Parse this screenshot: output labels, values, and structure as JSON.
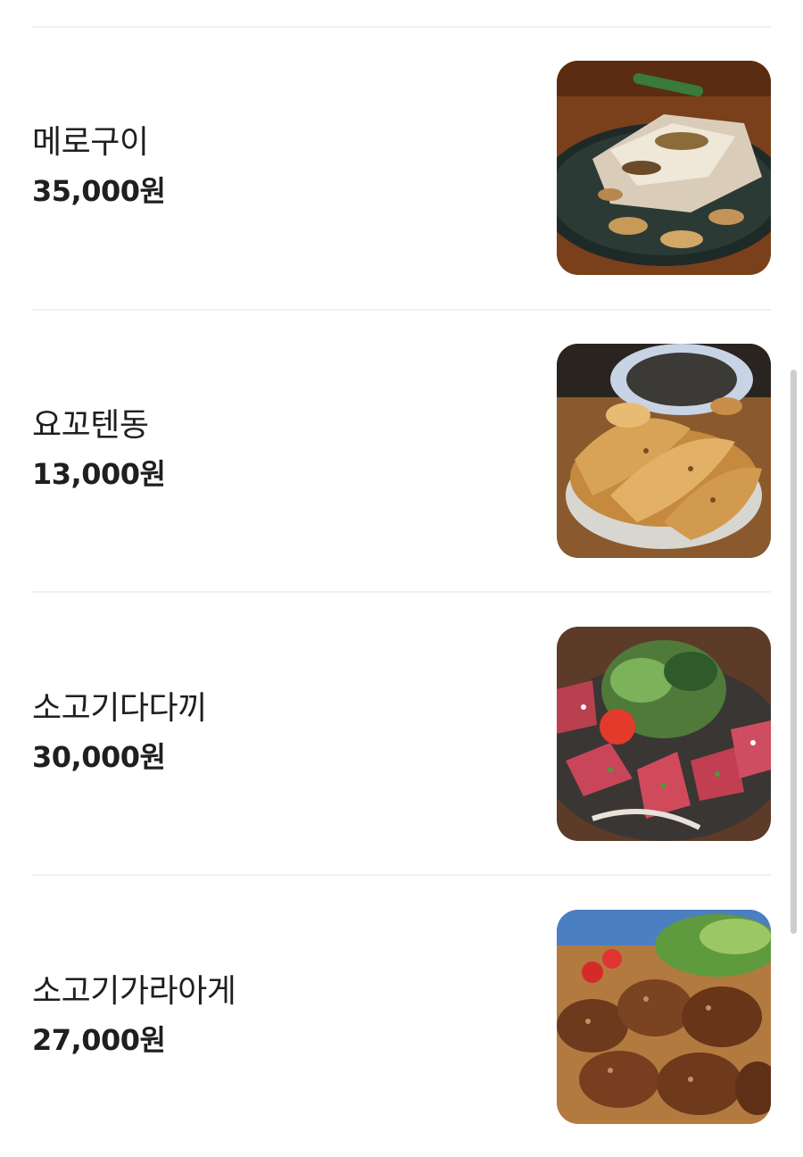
{
  "menu": {
    "items": [
      {
        "name": "메로구이",
        "price": "35,000원",
        "photo": "grilled-fish-photo"
      },
      {
        "name": "요꼬텐동",
        "price": "13,000원",
        "photo": "tempura-rice-bowl-photo"
      },
      {
        "name": "소고기다다끼",
        "price": "30,000원",
        "photo": "beef-tataki-salad-photo"
      },
      {
        "name": "소고기가라아게",
        "price": "27,000원",
        "photo": "fried-beef-karaage-photo"
      }
    ]
  }
}
